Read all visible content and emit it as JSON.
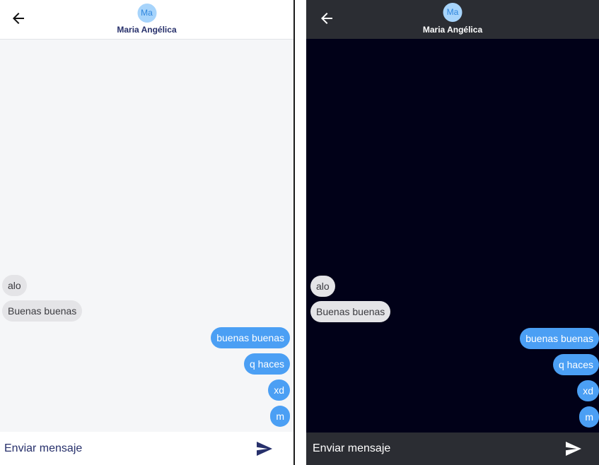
{
  "contact": {
    "initials": "Ma",
    "name": "Maria Angélica"
  },
  "messages": {
    "in_1": "alo",
    "in_2": "Buenas buenas",
    "out_1": "buenas buenas",
    "out_2": "q haces",
    "out_3": "xd",
    "out_4": "m"
  },
  "composer": {
    "placeholder": "Enviar mensaje"
  },
  "icons": {
    "back": "arrow-left-icon",
    "send": "send-icon"
  },
  "colors": {
    "light_background": "#f5f6f8",
    "dark_background": "#010118",
    "dark_header": "#2b2d33",
    "outgoing_bubble": "#4b9ff4",
    "incoming_bubble": "#e4e4e7",
    "avatar": "#a7d4fb",
    "accent_text": "#27306b"
  }
}
